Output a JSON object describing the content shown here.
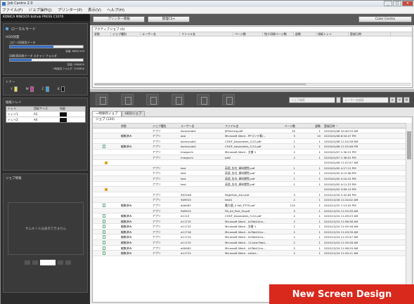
{
  "window": {
    "title": "Job Centro 2.0",
    "buttons": [
      "_",
      "□",
      "✕"
    ]
  },
  "menu": [
    "ファイル(F)",
    "ジョブ操作(J)",
    "プリンター(P)",
    "表示(V)",
    "ヘルプ(H)"
  ],
  "device": "KONICA MINOLTA bizhub PRESS C1070",
  "left": {
    "mode": "ローカルモード",
    "hdd_title": "HDD残量",
    "copy_label": "コピー/印刷用データ",
    "copy_cap": "容量: 868/1100",
    "scan_label": "印刷/再印刷データ スキャン フォルダ",
    "scan_cap": "容量: 266/800",
    "temp_cap": "一時保存フォルダ: 105/800",
    "toner_title": "トナー",
    "toners": [
      {
        "c": "#e8e24a",
        "n": "Y"
      },
      {
        "c": "#d8359a",
        "n": "M"
      },
      {
        "c": "#2ea6e0",
        "n": "C"
      },
      {
        "c": "#111111",
        "n": "K"
      }
    ],
    "tray_title": "給紙トレイ",
    "tray_headers": [
      "トレイ",
      "用紙サイズ",
      "残量"
    ],
    "trays": [
      {
        "name": "トレイ1",
        "size": "A3"
      },
      {
        "name": "トレイ2",
        "size": "A4"
      }
    ],
    "jobinfo_title": "ジョブ情報",
    "thumb_text": "サムネイルは表示できません"
  },
  "top_buttons": {
    "printer_info": "プリンター情報",
    "admin": "管理CS+",
    "color": "Color Centro"
  },
  "active": {
    "label": "アクティブジョブ (0)",
    "headers": [
      "状態",
      "ジョブ種別",
      "ユーザー名",
      "ファイル名",
      "ページ数",
      "残り印刷ページ数",
      "部数",
      "排紙トレイ",
      "登録日時"
    ]
  },
  "search": {
    "placeholder1": "ジョブ検索",
    "placeholder2": "ユーザー名検索"
  },
  "tabs": [
    "一時保存ジョブ",
    "HDDジョブ"
  ],
  "list": {
    "label": "ジョブ (120)",
    "headers": [
      "",
      "状態",
      "ジョブ種別",
      "ユーザー名",
      "ファイル名",
      "ページ数",
      "部数",
      "登録日時 ^"
    ],
    "rows": [
      [
        "",
        "",
        "アプリ",
        "konicaLab1",
        "JIMinenrg.pdf",
        "10",
        "1",
        "2015/01/06 10:40:33 AM"
      ],
      [
        "",
        "編集済み",
        "アプリ",
        "aoo",
        "Microsoft Word - PPコンテ案(...",
        "5",
        "10",
        "2015/01/06 8:54:47 PM"
      ],
      [
        "",
        "",
        "アプリ",
        "konicaLab1",
        "CHGF_Associates_3,22.pdf",
        "1",
        "1",
        "2015/01/06 11:24:28 AM"
      ],
      [
        "doc",
        "編集済み",
        "アプリ",
        "konicaLab1",
        "CHGF_Associates_3,22.pdf",
        "1",
        "1",
        "2015/01/06 11:25:46 PM"
      ],
      [
        "",
        "",
        "アプリ",
        "hnaguchi",
        "Microsoft Word - 文書 1",
        "2",
        "1",
        "2015/01/07 1:30:21 PM"
      ],
      [
        "",
        "",
        "アプリ",
        "hnaguchi",
        "job2",
        "2",
        "1",
        "2015/01/07 1:36:01 PM"
      ],
      [
        "lock",
        "",
        "",
        "",
        "",
        "",
        "",
        "2015/01/08 11:47:47 AM"
      ],
      [
        "",
        "",
        "アプリ",
        "test",
        "英語_告白_資料閲覧.pdf",
        "1",
        "1",
        "2015/01/05 4:17:11 PM"
      ],
      [
        "",
        "",
        "アプリ",
        "test",
        "英語_告白_資料閲覧.pdf",
        "1",
        "1",
        "2015/01/05 4:13:56 PM"
      ],
      [
        "",
        "",
        "アプリ",
        "test",
        "英語_告白_資料閲覧.pdf",
        "1",
        "1",
        "2015/01/05 4:10:22 PM"
      ],
      [
        "",
        "",
        "アプリ",
        "test",
        "英語_告白_資料閲覧.pdf",
        "1",
        "1",
        "2015/01/05 4:11:23 PM"
      ],
      [
        "lock",
        "",
        "",
        "",
        "",
        "",
        "",
        "2015/01/05 3:09:13 PM"
      ],
      [
        "",
        "",
        "アプリ",
        "903106",
        "PageSize_A4x.pdf",
        "3",
        "1",
        "2015/12/20 2:42:04 PM"
      ],
      [
        "",
        "",
        "アプリ",
        "909915",
        "test4",
        "2",
        "1",
        "2015/12/28 11:20:02 AM"
      ],
      [
        "doc",
        "編集済み",
        "アプリ",
        "a00005",
        "最大値_3 Set_PTTS.pdf",
        "115",
        "1",
        "2015/12/25 7:13:43 PM"
      ],
      [
        "",
        "",
        "アプリ",
        "909915",
        "FB_A4_Port_Yo.pdf",
        "5",
        "1",
        "2015/12/24 11:25:39 AM"
      ],
      [
        "doc",
        "編集済み",
        "アプリ",
        "e1115",
        "CHGF_Associates_3,22.pdf",
        "2",
        "1",
        "2015/12/24 11:49:23 AM"
      ],
      [
        "doc",
        "編集済み",
        "アプリ",
        "e11715",
        "Microsoft Word - A4Tab10ce...",
        "2",
        "1",
        "2015/12/24 11:36:38 AM"
      ],
      [
        "doc",
        "編集済み",
        "アプリ",
        "e11715",
        "Microsoft Word - 文書 1",
        "2",
        "1",
        "2015/12/24 11:29:16 AM"
      ],
      [
        "doc",
        "編集済み",
        "アプリ",
        "e11716",
        "Microsoft Word - A4Tab10ce...",
        "2",
        "1",
        "2015/12/24 11:29:39 AM"
      ],
      [
        "doc",
        "編集済み",
        "アプリ",
        "e11715",
        "Microsoft Word - A4Tab10ce...",
        "2",
        "1",
        "2015/12/24 11:15:47 AM"
      ],
      [
        "doc",
        "編集済み",
        "アプリ",
        "e11715",
        "Microsoft Word - 111sterTab4...",
        "2",
        "1",
        "2015/12/24 11:39:28 AM"
      ],
      [
        "doc",
        "編集済み",
        "アプリ",
        "a00005",
        "Microsoft Word - A4Tab12ce...",
        "2",
        "1",
        "2015/12/24 11:36:29 AM"
      ],
      [
        "doc",
        "編集済み",
        "アプリ",
        "a11715",
        "Microsoft Word - Letter...",
        "2",
        "1",
        "2015/12/24 11:30:11 AM"
      ]
    ]
  },
  "banner": "New Screen Design"
}
